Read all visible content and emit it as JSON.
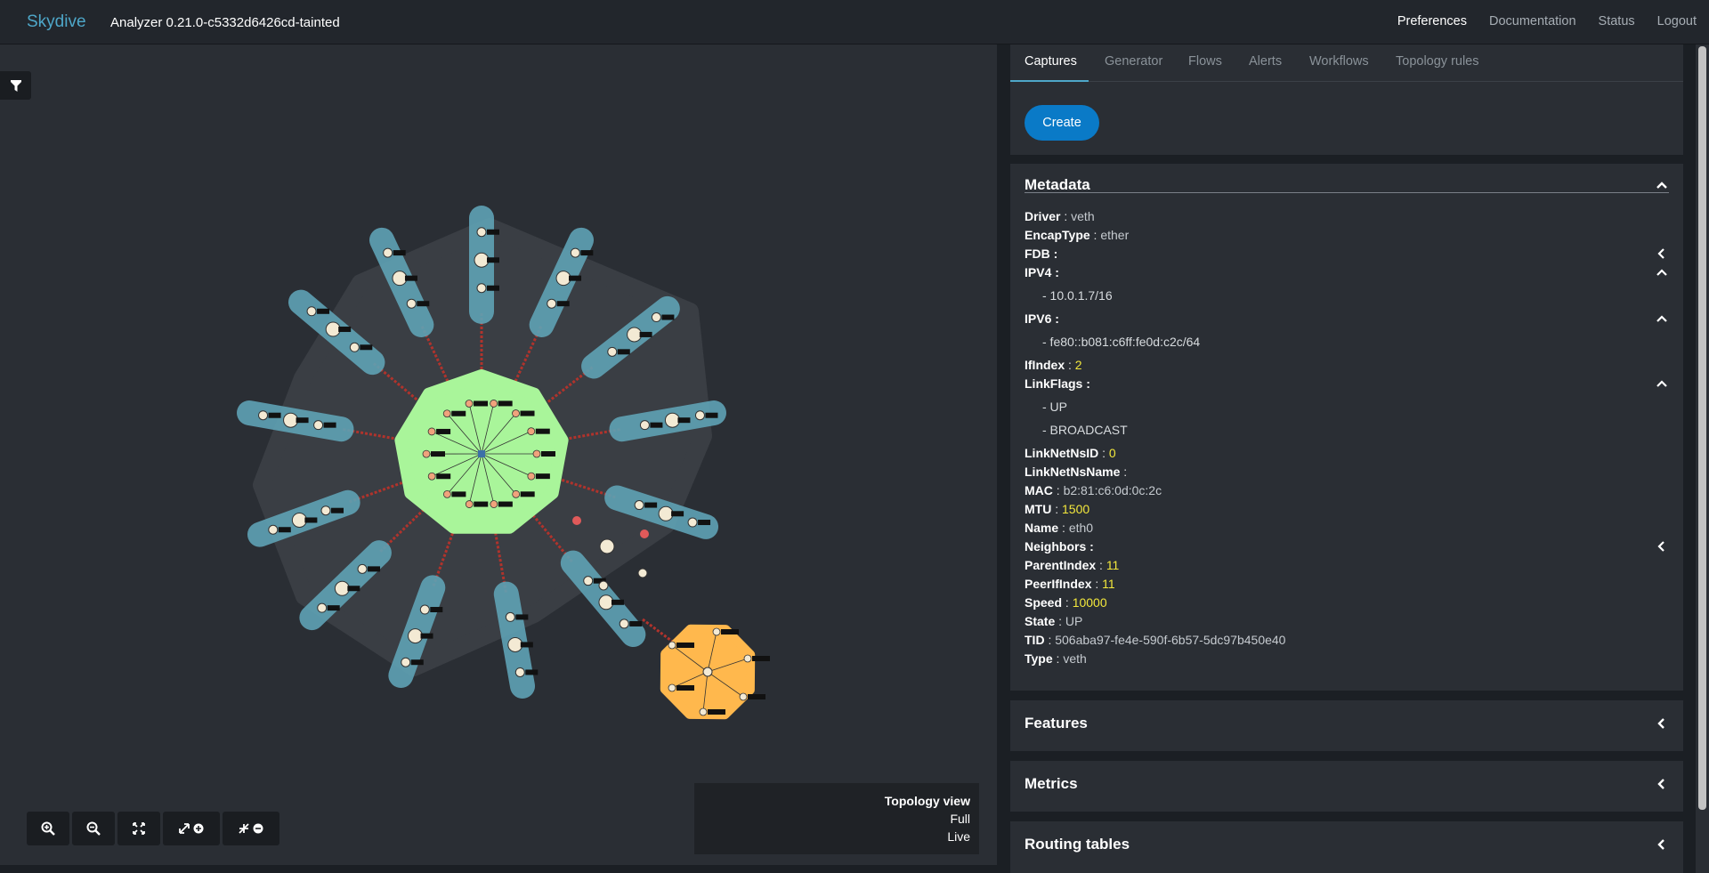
{
  "nav": {
    "brand": "Skydive",
    "version": "Analyzer 0.21.0-c5332d6426cd-tainted",
    "links": [
      "Preferences",
      "Documentation",
      "Status",
      "Logout"
    ]
  },
  "topology": {
    "legend_title": "Topology view",
    "legend_line1": "Full",
    "legend_line2": "Live",
    "zoom_buttons": [
      "zoom-in-icon",
      "zoom-out-icon",
      "fit-icon",
      "expand-icon",
      "collapse-icon"
    ]
  },
  "tabs": [
    "Captures",
    "Generator",
    "Flows",
    "Alerts",
    "Workflows",
    "Topology rules"
  ],
  "captures": {
    "create_label": "Create"
  },
  "metadata": {
    "title": "Metadata",
    "driver_k": "Driver",
    "driver_v": "veth",
    "encap_k": "EncapType",
    "encap_v": "ether",
    "fdb_k": "FDB :",
    "ipv4_k": "IPV4 :",
    "ipv4_v": "- 10.0.1.7/16",
    "ipv6_k": "IPV6 :",
    "ipv6_v": "- fe80::b081:c6ff:fe0d:c2c/64",
    "ifindex_k": "IfIndex",
    "ifindex_v": "2",
    "linkflags_k": "LinkFlags :",
    "linkflags_v1": "- UP",
    "linkflags_v2": "- BROADCAST",
    "netnsid_k": "LinkNetNsID",
    "netnsid_v": "0",
    "netnsname_k": "LinkNetNsName",
    "mac_k": "MAC",
    "mac_v": "b2:81:c6:0d:0c:2c",
    "mtu_k": "MTU",
    "mtu_v": "1500",
    "name_k": "Name",
    "name_v": "eth0",
    "neighbors_k": "Neighbors :",
    "parent_k": "ParentIndex",
    "parent_v": "11",
    "peer_k": "PeerIfIndex",
    "peer_v": "11",
    "speed_k": "Speed",
    "speed_v": "10000",
    "state_k": "State",
    "state_v": "UP",
    "tid_k": "TID",
    "tid_v": "506aba97-fe4e-590f-6b57-5dc97b450e40",
    "type_k": "Type",
    "type_v": "veth"
  },
  "sections": {
    "features": "Features",
    "metrics": "Metrics",
    "routing": "Routing tables"
  },
  "colors": {
    "accent": "#4ea7c9",
    "namespace": "#5fa2b5",
    "host": "#a9f59a",
    "switch": "#ffb84d",
    "number": "#f2e73c"
  }
}
